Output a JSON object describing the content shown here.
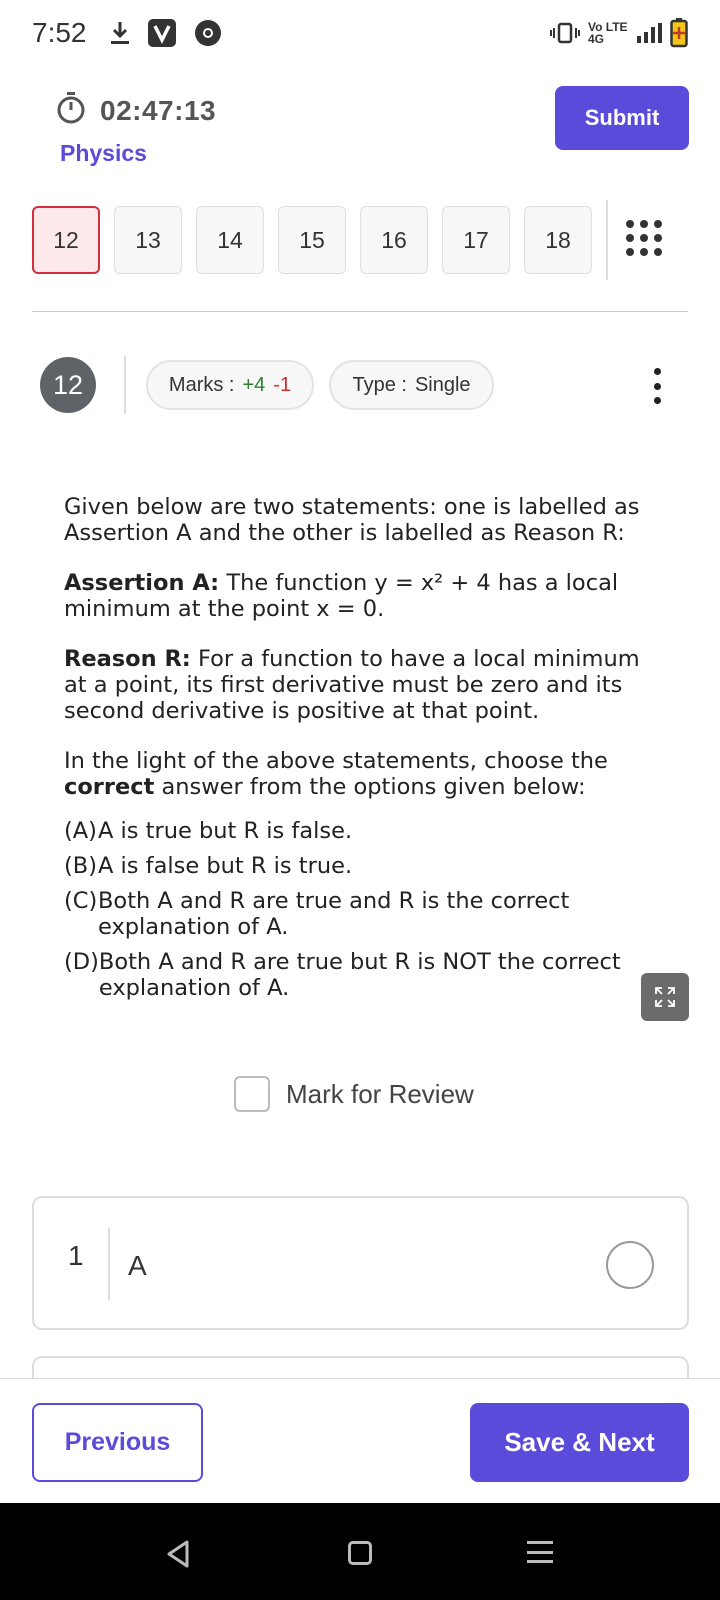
{
  "status_bar": {
    "time": "7:52",
    "network": "Vo LTE 4G",
    "icons": [
      "download-icon",
      "v-app-icon",
      "chrome-icon",
      "vibrate-icon",
      "signal-icon",
      "battery-icon"
    ]
  },
  "header": {
    "timer": "02:47:13",
    "subject": "Physics",
    "submit_label": "Submit"
  },
  "question_nav": {
    "items": [
      "12",
      "13",
      "14",
      "15",
      "16",
      "17",
      "18"
    ],
    "current": "12"
  },
  "question": {
    "number": "12",
    "marks_label": "Marks :",
    "marks_positive": "+4",
    "marks_negative": "-1",
    "type_label": "Type :",
    "type_value": "Single",
    "intro": "Given below are two statements: one is labelled as Assertion A and the other is labelled as Reason R:",
    "assertion_label": "Assertion A:",
    "assertion_text": " The function y = x² + 4 has a local minimum at the point x = 0.",
    "reason_label": "Reason R:",
    "reason_text": " For a function to have a local minimum at a point, its first derivative must be zero and its second derivative is positive at that point.",
    "prompt_before": "In the light of the above statements, choose the ",
    "prompt_bold": "correct",
    "prompt_after": " answer from the options given below:",
    "options": [
      {
        "label": "(A)",
        "text": "A is true but R is false."
      },
      {
        "label": "(B)",
        "text": "A is false but R is true."
      },
      {
        "label": "(C)",
        "text": "Both A and R are true and R is the correct explanation of A."
      },
      {
        "label": "(D)",
        "text": "Both A and R are true but R is NOT the correct explanation of A."
      }
    ],
    "review_label": "Mark for Review"
  },
  "answer_options": [
    {
      "number": "1",
      "text": "A"
    }
  ],
  "footer": {
    "previous_label": "Previous",
    "next_label": "Save & Next"
  },
  "colors": {
    "accent": "#5b4bdb",
    "current_border": "#d32f3f",
    "positive": "#2e7d32",
    "negative": "#d32f2f"
  }
}
